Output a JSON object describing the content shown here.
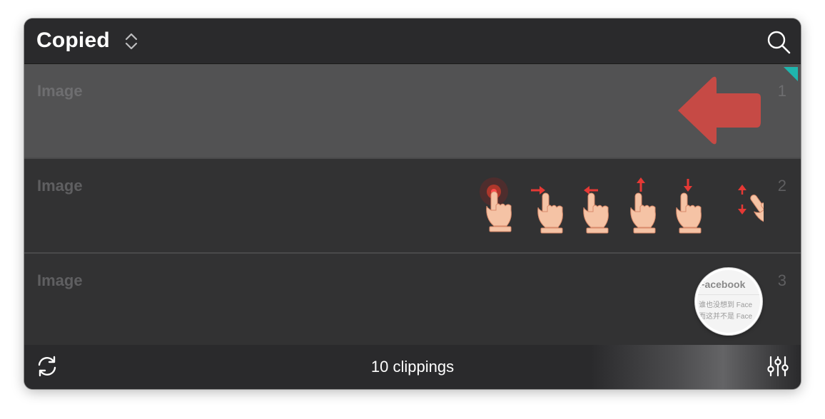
{
  "header": {
    "title": "Copied",
    "chevron_icon": "chevron-up-down-icon",
    "search_icon": "search-icon"
  },
  "rows": [
    {
      "kind": "Image",
      "index": "1",
      "thumbnail": "red-left-arrow",
      "selected": true
    },
    {
      "kind": "Image",
      "index": "2",
      "thumbnail": "hand-gesture-icons",
      "selected": false
    },
    {
      "kind": "Image",
      "index": "3",
      "thumbnail": "facebook-magnifier",
      "selected": false
    }
  ],
  "row3_thumb": {
    "title": "Facebook",
    "line1": "谁也没想到 Face",
    "line2": "而这并不是 Face"
  },
  "footer": {
    "count_label": "10 clippings",
    "refresh_icon": "refresh-icon",
    "filter_icon": "sliders-icon"
  },
  "colors": {
    "accent_marker": "#1fb5ad",
    "arrow_red": "#c64a45",
    "background": "#2a2a2c",
    "selected_row": "#525253"
  }
}
